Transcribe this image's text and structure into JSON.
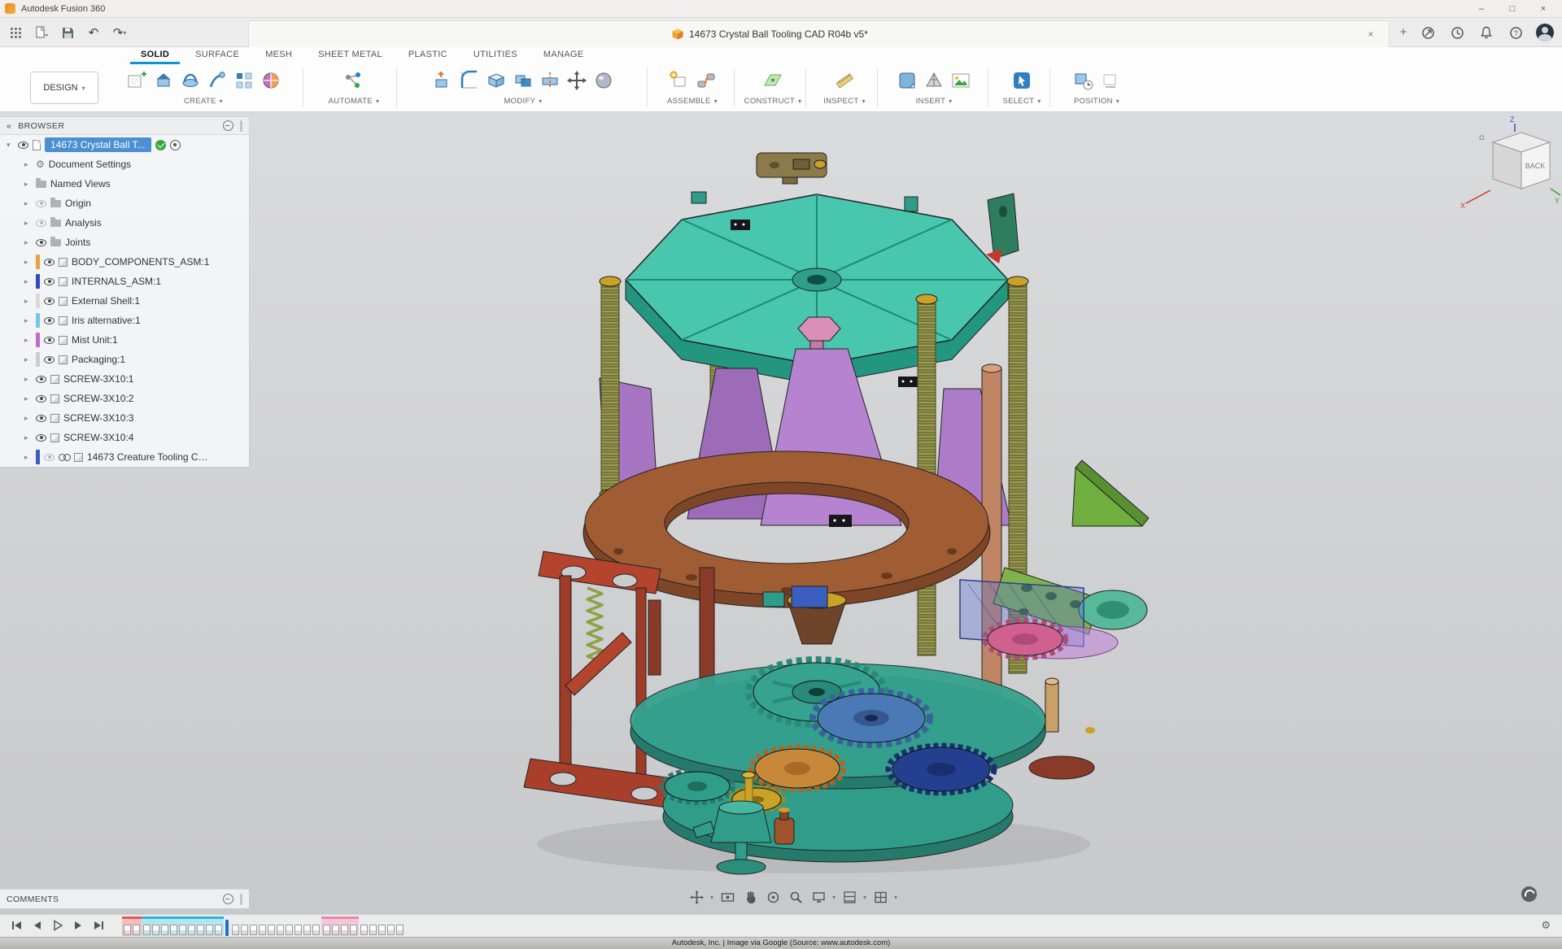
{
  "window": {
    "title": "Autodesk Fusion 360",
    "minimize": "–",
    "maximize": "□",
    "close": "×"
  },
  "tab_bar": {
    "document_title": "14673 Crystal Ball Tooling CAD R04b v5*",
    "close": "×",
    "new_tab": "+"
  },
  "ribbon": {
    "design_selector": "DESIGN",
    "tabs": [
      {
        "label": "SOLID",
        "active": true
      },
      {
        "label": "SURFACE"
      },
      {
        "label": "MESH"
      },
      {
        "label": "SHEET METAL"
      },
      {
        "label": "PLASTIC"
      },
      {
        "label": "UTILITIES"
      },
      {
        "label": "MANAGE"
      }
    ],
    "groups": [
      {
        "label": "CREATE"
      },
      {
        "label": "AUTOMATE"
      },
      {
        "label": "MODIFY"
      },
      {
        "label": "ASSEMBLE"
      },
      {
        "label": "CONSTRUCT"
      },
      {
        "label": "INSPECT"
      },
      {
        "label": "INSERT"
      },
      {
        "label": "SELECT"
      },
      {
        "label": "POSITION"
      }
    ]
  },
  "browser": {
    "header": "BROWSER",
    "root_label": "14673 Crystal Ball T...",
    "items": [
      {
        "label": "Document Settings",
        "icon": "gear"
      },
      {
        "label": "Named Views",
        "icon": "folder"
      },
      {
        "label": "Origin",
        "icon": "folder",
        "visibility": "hidden"
      },
      {
        "label": "Analysis",
        "icon": "folder",
        "visibility": "hidden"
      },
      {
        "label": "Joints",
        "icon": "folder",
        "visibility": "visible"
      },
      {
        "label": "BODY_COMPONENTS_ASM:1",
        "icon": "component",
        "color": "#e8a33d",
        "visibility": "visible"
      },
      {
        "label": "INTERNALS_ASM:1",
        "icon": "component",
        "color": "#2f4bc4",
        "visibility": "visible"
      },
      {
        "label": "External Shell:1",
        "icon": "component",
        "color": "#d9d9d9",
        "visibility": "visible"
      },
      {
        "label": "Iris alternative:1",
        "icon": "component",
        "color": "#74c6e8",
        "visibility": "visible"
      },
      {
        "label": "Mist Unit:1",
        "icon": "component",
        "color": "#c06bc9",
        "visibility": "visible"
      },
      {
        "label": "Packaging:1",
        "icon": "component",
        "color": "#cccccc",
        "visibility": "visible"
      },
      {
        "label": "SCREW-3X10:1",
        "icon": "component",
        "visibility": "visible"
      },
      {
        "label": "SCREW-3X10:2",
        "icon": "component",
        "visibility": "visible"
      },
      {
        "label": "SCREW-3X10:3",
        "icon": "component",
        "visibility": "visible"
      },
      {
        "label": "SCREW-3X10:4",
        "icon": "component",
        "visibility": "visible"
      },
      {
        "label": "14673 Creature Tooling CAD ...",
        "icon": "linked-component",
        "color": "#3a5fc0",
        "visibility": "hidden"
      }
    ]
  },
  "viewcube": {
    "face_label": "BACK",
    "axis_x": "X",
    "axis_y": "Y",
    "axis_z": "Z",
    "home": "⌂"
  },
  "comments": {
    "header": "COMMENTS"
  },
  "nav_toolbar": {
    "icons": [
      "fit",
      "look-at",
      "pan",
      "orbit",
      "zoom",
      "display-settings",
      "grid-snaps",
      "viewports"
    ]
  },
  "timeline": {
    "controls": [
      "go-to-start",
      "step-back",
      "play",
      "step-forward",
      "go-to-end"
    ],
    "segments": [
      {
        "count": 2,
        "tint": "#f5bcbc",
        "bar": "#e05a5a"
      },
      {
        "count": 9,
        "tint": "#b4e4ee",
        "bar": "#25b6d8"
      },
      {
        "count": 10,
        "tint": "",
        "bar": ""
      },
      {
        "count": 4,
        "tint": "#f6c6d8",
        "bar": "#e887ad"
      },
      {
        "count": 5,
        "tint": "",
        "bar": ""
      }
    ],
    "marker_after_segment": 2
  },
  "footer": {
    "attribution": "Autodesk, Inc. | Image via Google (Source: www.autodesk.com)"
  },
  "colors": {
    "accent_blue": "#0696d7",
    "selection_blue": "#4a90d2",
    "canvas_top": "#dadbdc",
    "canvas_bottom": "#c8c9cb"
  }
}
